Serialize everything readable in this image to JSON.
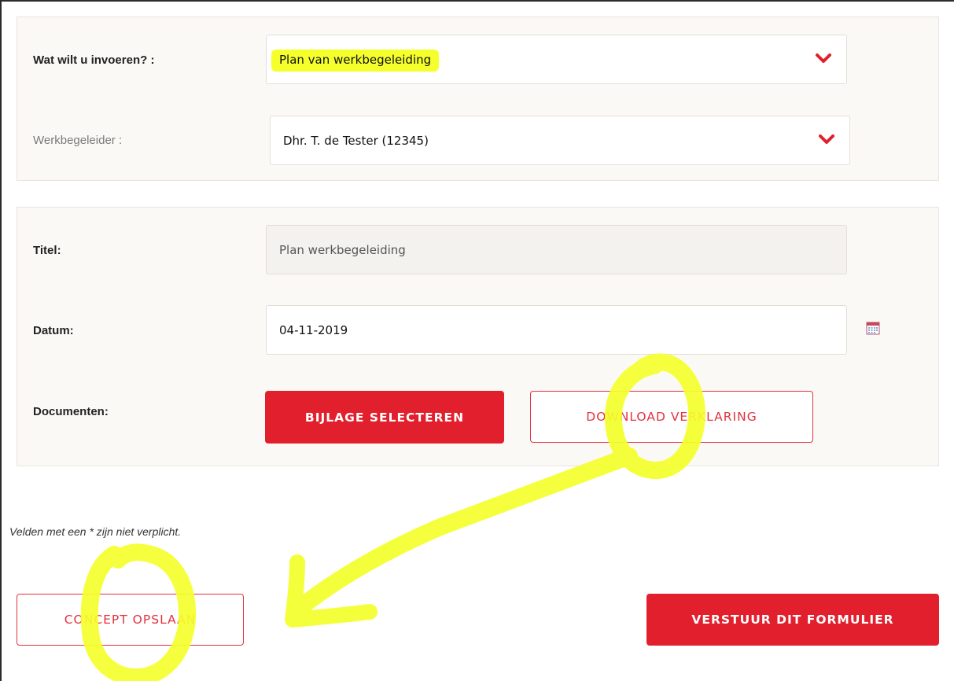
{
  "selection_panel": {
    "entry_type_label": "Wat wilt u invoeren? :",
    "entry_type_value": "Plan van werkbegeleiding",
    "supervisor_label": "Werkbegeleider :",
    "supervisor_value": "Dhr. T. de Tester (12345)"
  },
  "details_panel": {
    "title_label": "Titel:",
    "title_value": "Plan werkbegeleiding",
    "date_label": "Datum:",
    "date_value": "04-11-2019",
    "documents_label": "Documenten:",
    "select_attachment_label": "BIJLAGE SELECTEREN",
    "download_statement_label": "DOWNLOAD VERKLARING"
  },
  "note": "Velden met een * zijn niet verplicht.",
  "footer": {
    "save_concept_label": "CONCEPT OPSLAAN",
    "submit_label": "VERSTUUR DIT FORMULIER"
  },
  "icons": {
    "dropdown": "chevron-down-icon",
    "calendar": "calendar-icon"
  },
  "colors": {
    "accent": "#e21f2c",
    "panel_background": "#fbf9f6",
    "annotation_highlight": "#f4ff2c"
  }
}
